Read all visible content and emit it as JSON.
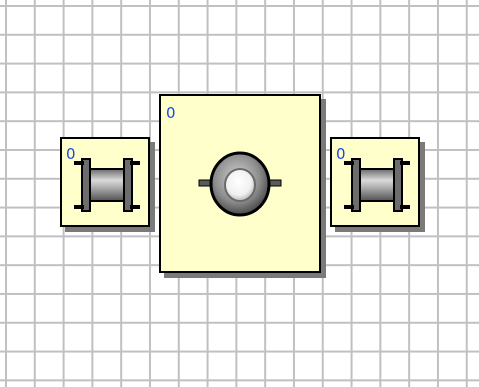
{
  "diagram": {
    "background": "#ffffff",
    "grid_color": "#c0c0c0",
    "block_fill": "#ffffcc",
    "counter_color": "#1a47e6",
    "blocks": [
      {
        "id": "left-pipe",
        "kind": "pipe",
        "icon": "pipe-icon",
        "counter": "0"
      },
      {
        "id": "center-valve",
        "kind": "valve",
        "icon": "valve-icon",
        "counter": "0"
      },
      {
        "id": "right-pipe",
        "kind": "pipe",
        "icon": "pipe-icon",
        "counter": "0"
      }
    ]
  }
}
